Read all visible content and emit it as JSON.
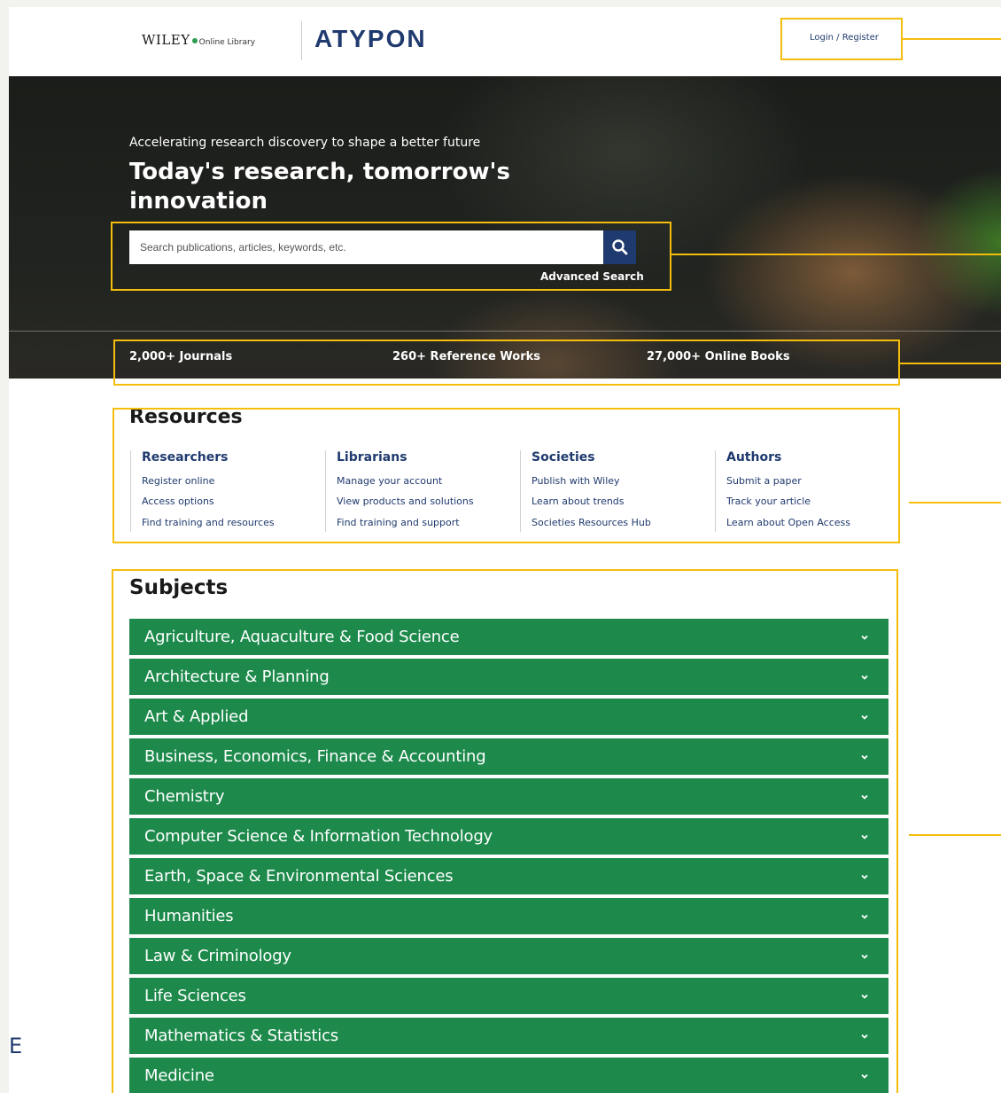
{
  "header": {
    "wiley_brand": "WILEY",
    "wiley_sub": "Online Library",
    "atypon_brand": "ATYPON",
    "login_label": "Login / Register"
  },
  "hero": {
    "tagline": "Accelerating research discovery to shape a better future",
    "title": "Today's research, tomorrow's innovation",
    "search_placeholder": "Search publications, articles, keywords, etc.",
    "advanced_search_label": "Advanced Search",
    "stats": [
      {
        "label": "2,000+ Journals"
      },
      {
        "label": "260+ Reference Works"
      },
      {
        "label": "27,000+ Online Books"
      }
    ]
  },
  "resources": {
    "title": "Resources",
    "columns": [
      {
        "heading": "Researchers",
        "links": [
          "Register online",
          "Access options",
          "Find training and resources"
        ]
      },
      {
        "heading": "Librarians",
        "links": [
          "Manage your account",
          "View products and solutions",
          "Find training and support"
        ]
      },
      {
        "heading": "Societies",
        "links": [
          "Publish with Wiley",
          "Learn about trends",
          "Societies Resources Hub"
        ]
      },
      {
        "heading": "Authors",
        "links": [
          "Submit a paper",
          "Track your article",
          "Learn about Open Access"
        ]
      }
    ]
  },
  "subjects": {
    "title": "Subjects",
    "items": [
      "Agriculture, Aquaculture & Food Science",
      "Architecture & Planning",
      "Art & Applied",
      "Business, Economics, Finance & Accounting",
      "Chemistry",
      "Computer Science & Information Technology",
      "Earth, Space & Environmental Sciences",
      "Humanities",
      "Law & Criminology",
      "Life Sciences",
      "Mathematics & Statistics",
      "Medicine"
    ]
  },
  "side_letter": "E",
  "colors": {
    "accent_navy": "#1f3a6e",
    "subject_green": "#1d8a4c",
    "highlight_yellow": "#f5bd0c"
  }
}
